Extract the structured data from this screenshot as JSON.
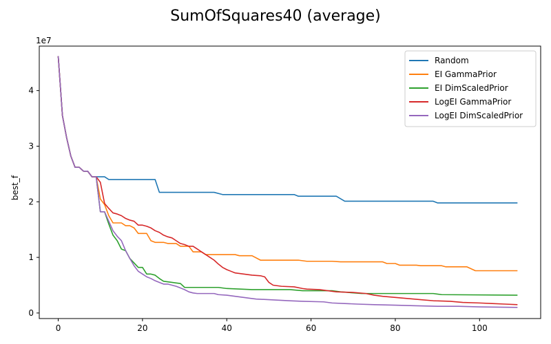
{
  "chart_data": {
    "type": "line",
    "title": "SumOfSquares40 (average)",
    "xlabel": "",
    "ylabel": "best_f",
    "y_scale_note": "1e7",
    "xlim": [
      -4.5,
      114.5
    ],
    "ylim": [
      -0.1,
      4.8
    ],
    "xticks": [
      0,
      20,
      40,
      60,
      80,
      100
    ],
    "yticks": [
      0,
      1,
      2,
      3,
      4
    ],
    "legend_position": "top-right",
    "series": [
      {
        "name": "Random",
        "color": "#1f77b4",
        "points": [
          [
            0,
            4.62
          ],
          [
            1,
            3.55
          ],
          [
            2,
            3.15
          ],
          [
            3,
            2.82
          ],
          [
            4,
            2.62
          ],
          [
            5,
            2.62
          ],
          [
            6,
            2.55
          ],
          [
            7,
            2.55
          ],
          [
            8,
            2.45
          ],
          [
            9,
            2.45
          ],
          [
            10,
            2.45
          ],
          [
            11,
            2.45
          ],
          [
            12,
            2.4
          ],
          [
            23,
            2.4
          ],
          [
            24,
            2.17
          ],
          [
            37,
            2.17
          ],
          [
            39,
            2.13
          ],
          [
            56,
            2.13
          ],
          [
            57,
            2.1
          ],
          [
            66,
            2.1
          ],
          [
            68,
            2.01
          ],
          [
            89,
            2.01
          ],
          [
            90,
            1.98
          ],
          [
            109,
            1.98
          ]
        ]
      },
      {
        "name": "EI GammaPrior",
        "color": "#ff7f0e",
        "points": [
          [
            0,
            4.62
          ],
          [
            1,
            3.55
          ],
          [
            2,
            3.15
          ],
          [
            3,
            2.82
          ],
          [
            4,
            2.62
          ],
          [
            5,
            2.62
          ],
          [
            6,
            2.55
          ],
          [
            7,
            2.55
          ],
          [
            8,
            2.45
          ],
          [
            9,
            2.45
          ],
          [
            10,
            2.05
          ],
          [
            11,
            1.95
          ],
          [
            12,
            1.75
          ],
          [
            13,
            1.62
          ],
          [
            15,
            1.62
          ],
          [
            16,
            1.57
          ],
          [
            17,
            1.57
          ],
          [
            18,
            1.53
          ],
          [
            19,
            1.43
          ],
          [
            21,
            1.43
          ],
          [
            22,
            1.3
          ],
          [
            23,
            1.27
          ],
          [
            25,
            1.27
          ],
          [
            26,
            1.25
          ],
          [
            28,
            1.25
          ],
          [
            29,
            1.2
          ],
          [
            31,
            1.2
          ],
          [
            32,
            1.1
          ],
          [
            34,
            1.1
          ],
          [
            35,
            1.05
          ],
          [
            42,
            1.05
          ],
          [
            43,
            1.03
          ],
          [
            46,
            1.03
          ],
          [
            48,
            0.95
          ],
          [
            57,
            0.95
          ],
          [
            59,
            0.93
          ],
          [
            65,
            0.93
          ],
          [
            67,
            0.92
          ],
          [
            77,
            0.92
          ],
          [
            78,
            0.89
          ],
          [
            80,
            0.89
          ],
          [
            81,
            0.86
          ],
          [
            85,
            0.86
          ],
          [
            86,
            0.85
          ],
          [
            91,
            0.85
          ],
          [
            92,
            0.83
          ],
          [
            97,
            0.83
          ],
          [
            99,
            0.76
          ],
          [
            109,
            0.76
          ]
        ]
      },
      {
        "name": "EI DimScaledPrior",
        "color": "#2ca02c",
        "points": [
          [
            0,
            4.62
          ],
          [
            1,
            3.55
          ],
          [
            2,
            3.15
          ],
          [
            3,
            2.82
          ],
          [
            4,
            2.62
          ],
          [
            5,
            2.62
          ],
          [
            6,
            2.55
          ],
          [
            7,
            2.55
          ],
          [
            8,
            2.45
          ],
          [
            9,
            2.45
          ],
          [
            10,
            1.82
          ],
          [
            11,
            1.82
          ],
          [
            12,
            1.6
          ],
          [
            13,
            1.4
          ],
          [
            14,
            1.3
          ],
          [
            15,
            1.15
          ],
          [
            16,
            1.12
          ],
          [
            17,
            0.98
          ],
          [
            18,
            0.9
          ],
          [
            19,
            0.82
          ],
          [
            20,
            0.82
          ],
          [
            21,
            0.7
          ],
          [
            22,
            0.7
          ],
          [
            23,
            0.68
          ],
          [
            24,
            0.62
          ],
          [
            25,
            0.57
          ],
          [
            27,
            0.55
          ],
          [
            29,
            0.53
          ],
          [
            30,
            0.46
          ],
          [
            38,
            0.46
          ],
          [
            40,
            0.44
          ],
          [
            46,
            0.42
          ],
          [
            55,
            0.42
          ],
          [
            58,
            0.4
          ],
          [
            65,
            0.4
          ],
          [
            67,
            0.38
          ],
          [
            72,
            0.35
          ],
          [
            89,
            0.35
          ],
          [
            91,
            0.33
          ],
          [
            109,
            0.32
          ]
        ]
      },
      {
        "name": "LogEI GammaPrior",
        "color": "#d62728",
        "points": [
          [
            0,
            4.62
          ],
          [
            1,
            3.55
          ],
          [
            2,
            3.15
          ],
          [
            3,
            2.82
          ],
          [
            4,
            2.62
          ],
          [
            5,
            2.62
          ],
          [
            6,
            2.55
          ],
          [
            7,
            2.55
          ],
          [
            8,
            2.45
          ],
          [
            9,
            2.45
          ],
          [
            10,
            2.35
          ],
          [
            11,
            1.97
          ],
          [
            12,
            1.88
          ],
          [
            13,
            1.8
          ],
          [
            14,
            1.78
          ],
          [
            15,
            1.75
          ],
          [
            16,
            1.7
          ],
          [
            17,
            1.67
          ],
          [
            18,
            1.65
          ],
          [
            19,
            1.58
          ],
          [
            20,
            1.58
          ],
          [
            21,
            1.56
          ],
          [
            22,
            1.53
          ],
          [
            23,
            1.48
          ],
          [
            24,
            1.45
          ],
          [
            25,
            1.4
          ],
          [
            26,
            1.37
          ],
          [
            27,
            1.35
          ],
          [
            28,
            1.3
          ],
          [
            29,
            1.25
          ],
          [
            30,
            1.23
          ],
          [
            31,
            1.2
          ],
          [
            32,
            1.2
          ],
          [
            33,
            1.15
          ],
          [
            34,
            1.1
          ],
          [
            35,
            1.05
          ],
          [
            36,
            1.0
          ],
          [
            37,
            0.95
          ],
          [
            38,
            0.88
          ],
          [
            39,
            0.82
          ],
          [
            40,
            0.78
          ],
          [
            41,
            0.75
          ],
          [
            42,
            0.72
          ],
          [
            44,
            0.7
          ],
          [
            46,
            0.68
          ],
          [
            48,
            0.67
          ],
          [
            49,
            0.65
          ],
          [
            50,
            0.55
          ],
          [
            51,
            0.5
          ],
          [
            53,
            0.48
          ],
          [
            56,
            0.47
          ],
          [
            58,
            0.44
          ],
          [
            59,
            0.43
          ],
          [
            62,
            0.42
          ],
          [
            64,
            0.4
          ],
          [
            66,
            0.38
          ],
          [
            70,
            0.37
          ],
          [
            73,
            0.35
          ],
          [
            75,
            0.32
          ],
          [
            77,
            0.3
          ],
          [
            80,
            0.28
          ],
          [
            83,
            0.26
          ],
          [
            86,
            0.24
          ],
          [
            89,
            0.22
          ],
          [
            93,
            0.21
          ],
          [
            96,
            0.19
          ],
          [
            100,
            0.18
          ],
          [
            103,
            0.17
          ],
          [
            106,
            0.16
          ],
          [
            109,
            0.15
          ]
        ]
      },
      {
        "name": "LogEI DimScaledPrior",
        "color": "#9467bd",
        "points": [
          [
            0,
            4.62
          ],
          [
            1,
            3.55
          ],
          [
            2,
            3.15
          ],
          [
            3,
            2.82
          ],
          [
            4,
            2.62
          ],
          [
            5,
            2.62
          ],
          [
            6,
            2.55
          ],
          [
            7,
            2.55
          ],
          [
            8,
            2.45
          ],
          [
            9,
            2.45
          ],
          [
            10,
            1.82
          ],
          [
            11,
            1.82
          ],
          [
            12,
            1.65
          ],
          [
            13,
            1.48
          ],
          [
            14,
            1.38
          ],
          [
            15,
            1.3
          ],
          [
            16,
            1.12
          ],
          [
            17,
            0.98
          ],
          [
            18,
            0.85
          ],
          [
            19,
            0.75
          ],
          [
            20,
            0.7
          ],
          [
            21,
            0.65
          ],
          [
            22,
            0.62
          ],
          [
            23,
            0.58
          ],
          [
            24,
            0.55
          ],
          [
            25,
            0.52
          ],
          [
            26,
            0.52
          ],
          [
            27,
            0.5
          ],
          [
            28,
            0.48
          ],
          [
            29,
            0.45
          ],
          [
            30,
            0.42
          ],
          [
            31,
            0.38
          ],
          [
            32,
            0.36
          ],
          [
            33,
            0.35
          ],
          [
            37,
            0.35
          ],
          [
            38,
            0.33
          ],
          [
            40,
            0.32
          ],
          [
            42,
            0.3
          ],
          [
            44,
            0.28
          ],
          [
            46,
            0.26
          ],
          [
            47,
            0.25
          ],
          [
            50,
            0.24
          ],
          [
            55,
            0.22
          ],
          [
            58,
            0.21
          ],
          [
            63,
            0.2
          ],
          [
            65,
            0.18
          ],
          [
            68,
            0.17
          ],
          [
            71,
            0.16
          ],
          [
            75,
            0.15
          ],
          [
            80,
            0.14
          ],
          [
            85,
            0.13
          ],
          [
            90,
            0.12
          ],
          [
            95,
            0.12
          ],
          [
            100,
            0.11
          ],
          [
            109,
            0.1
          ]
        ]
      }
    ]
  }
}
